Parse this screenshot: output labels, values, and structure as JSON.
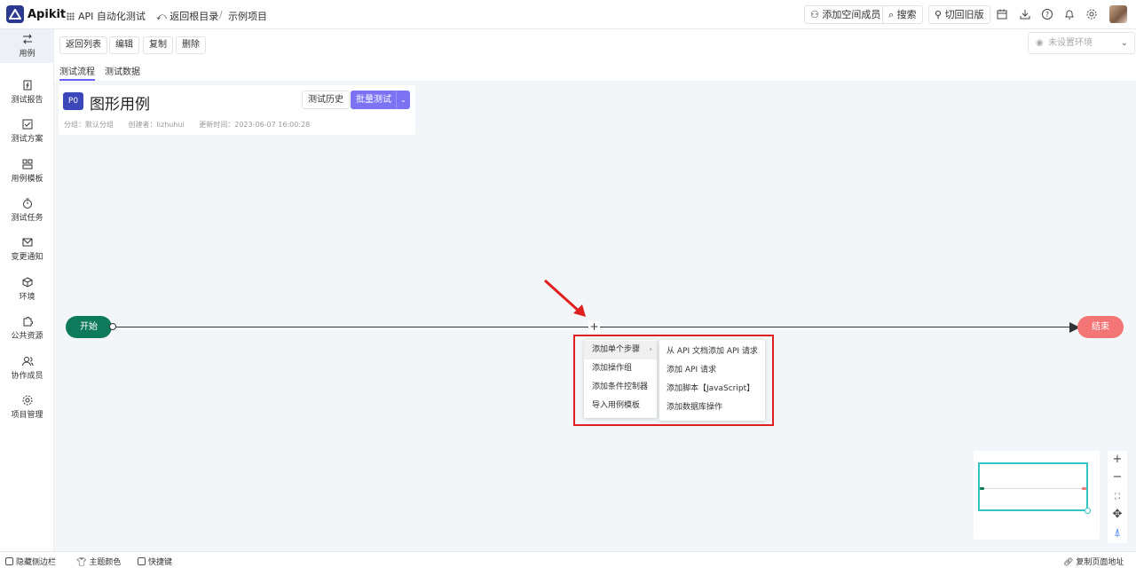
{
  "header": {
    "brand": "Apikit",
    "workspace": "API 自动化测试",
    "back_root": "返回根目录",
    "separator": "/",
    "project": "示例项目",
    "add_member": "添加空间成员",
    "search": "搜索",
    "switch_old": "切回旧版",
    "icons": [
      "calendar-icon",
      "download-icon",
      "help-icon",
      "bell-icon",
      "gear-icon"
    ]
  },
  "sidebar": {
    "items": [
      {
        "label": "用例",
        "icon": "flow-icon",
        "active": true
      },
      {
        "label": "测试报告",
        "icon": "report-icon"
      },
      {
        "label": "测试方案",
        "icon": "plan-icon"
      },
      {
        "label": "用例模板",
        "icon": "template-icon"
      },
      {
        "label": "测试任务",
        "icon": "timer-icon"
      },
      {
        "label": "变更通知",
        "icon": "mail-icon"
      },
      {
        "label": "环境",
        "icon": "cube-icon"
      },
      {
        "label": "公共资源",
        "icon": "puzzle-icon"
      },
      {
        "label": "协作成员",
        "icon": "users-icon"
      },
      {
        "label": "项目管理",
        "icon": "settings-icon"
      }
    ]
  },
  "actions": {
    "back_list": "返回列表",
    "edit": "编辑",
    "copy": "复制",
    "delete": "删除",
    "tabs": [
      {
        "label": "测试流程",
        "active": true
      },
      {
        "label": "测试数据",
        "active": false
      }
    ],
    "env_placeholder": "未设置环境"
  },
  "case": {
    "priority": "P0",
    "title": "图形用例",
    "group": "分组：默认分组",
    "creator": "创建者：lizhuhui",
    "updated": "更新时间：2023-06-07 16:00:28",
    "history_button": "测试历史",
    "batch_button": "批量测试"
  },
  "flow": {
    "start_label": "开始",
    "end_label": "结束",
    "add_symbol": "+",
    "start_color": "#0d7a5c",
    "end_color": "#f47575"
  },
  "context_menu": {
    "items": [
      "添加单个步骤",
      "添加操作组",
      "添加条件控制器",
      "导入用例模板"
    ],
    "submenu": [
      "从 API 文档添加 API 请求",
      "添加 API 请求",
      "添加脚本【JavaScript】",
      "添加数据库操作"
    ]
  },
  "zoom_controls": [
    "+",
    "−"
  ],
  "footer": {
    "hide_sidebar": "隐藏侧边栏",
    "theme": "主题颜色",
    "shortcuts": "快捷键",
    "copy_url": "复制页面地址"
  }
}
